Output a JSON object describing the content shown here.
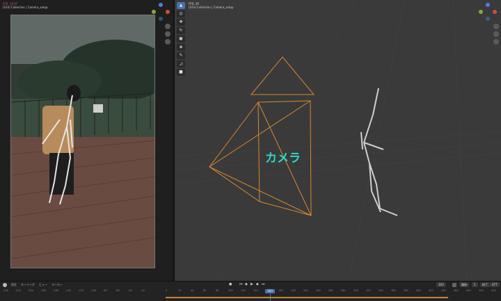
{
  "left_view": {
    "fps": "FPS: 10.67",
    "collection": "(163) Collection | Camera_setup"
  },
  "right_view": {
    "fps": "FPS: 29",
    "collection": "(163) Collection | Camera_setup",
    "overlay_label": "カメラ"
  },
  "toolbar": {
    "tools": [
      "select-cursor-icon",
      "cursor-icon",
      "move-icon",
      "rotate-icon",
      "scale-icon",
      "transform-icon",
      "annotate-icon",
      "measure-icon",
      "add-cube-icon"
    ]
  },
  "timeline": {
    "menus": [
      "再生",
      "キーイング",
      "ビュー",
      "マーカー"
    ],
    "ticks": [
      "-240",
      "-220",
      "-200",
      "-180",
      "-160",
      "-140",
      "-120",
      "-100",
      "-80",
      "-60",
      "-40",
      "-20",
      "0",
      "20",
      "40",
      "60",
      "80",
      "100",
      "120",
      "140",
      "160",
      "180",
      "200",
      "220",
      "240",
      "260",
      "280",
      "300",
      "320",
      "340",
      "360",
      "380",
      "400",
      "420",
      "440",
      "460",
      "480",
      "500",
      "520"
    ],
    "current_frame": "163",
    "current_frame_field": "163",
    "start_label": "開始",
    "start_value": "1",
    "end_label": "終了",
    "end_value": "477"
  }
}
